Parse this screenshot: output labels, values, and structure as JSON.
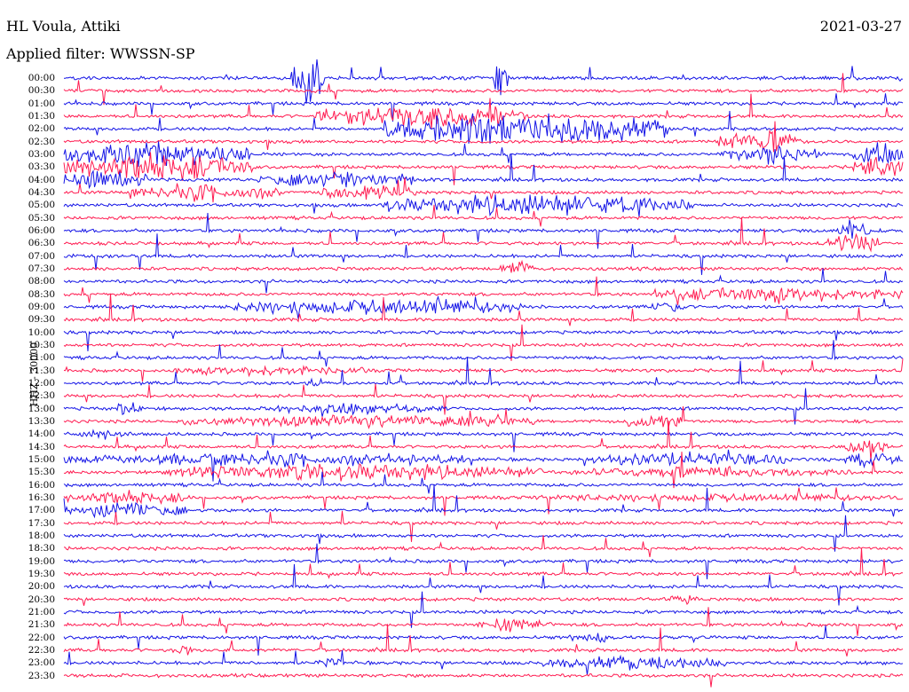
{
  "header": {
    "station": "HL Voula, Attiki",
    "filter": "Applied filter: WWSSN-SP",
    "date": "2021-03-27",
    "channel": "HHZ - 30000"
  },
  "colors": {
    "blue": "#1414e6",
    "red": "#ff1a50"
  },
  "chart_data": {
    "type": "line",
    "title": "HL Voula, Attiki",
    "subtitle": "Applied filter: WWSSN-SP",
    "ylabel": "HHZ - 30000",
    "xlabel": "",
    "grid": false,
    "row_labels": [
      "00:00",
      "00:30",
      "01:00",
      "01:30",
      "02:00",
      "02:30",
      "03:00",
      "03:30",
      "04:00",
      "04:30",
      "05:00",
      "05:30",
      "06:00",
      "06:30",
      "07:00",
      "07:30",
      "08:00",
      "08:30",
      "09:00",
      "09:30",
      "10:00",
      "10:30",
      "11:00",
      "11:30",
      "12:00",
      "12:30",
      "13:00",
      "13:30",
      "14:00",
      "14:30",
      "15:00",
      "15:30",
      "16:00",
      "16:30",
      "17:00",
      "17:30",
      "18:00",
      "18:30",
      "19:00",
      "19:30",
      "20:00",
      "20:30",
      "21:00",
      "21:30",
      "22:00",
      "22:30",
      "23:00",
      "23:30"
    ],
    "series_colors": [
      "blue",
      "red"
    ],
    "trace_minutes": 30,
    "background_amplitude": 0.12,
    "events": [
      {
        "row": 0,
        "start": 0.27,
        "end": 0.31,
        "amplitude": 3.0
      },
      {
        "row": 0,
        "start": 0.51,
        "end": 0.53,
        "amplitude": 2.5
      },
      {
        "row": 3,
        "start": 0.3,
        "end": 0.55,
        "amplitude": 1.4
      },
      {
        "row": 4,
        "start": 0.38,
        "end": 0.72,
        "amplitude": 1.8
      },
      {
        "row": 5,
        "start": 0.78,
        "end": 0.88,
        "amplitude": 1.2
      },
      {
        "row": 6,
        "start": 0.0,
        "end": 0.22,
        "amplitude": 1.6
      },
      {
        "row": 6,
        "start": 0.78,
        "end": 0.9,
        "amplitude": 1.0
      },
      {
        "row": 6,
        "start": 0.94,
        "end": 1.0,
        "amplitude": 1.4
      },
      {
        "row": 7,
        "start": 0.0,
        "end": 0.22,
        "amplitude": 1.6
      },
      {
        "row": 7,
        "start": 0.94,
        "end": 1.0,
        "amplitude": 1.2
      },
      {
        "row": 8,
        "start": 0.0,
        "end": 0.1,
        "amplitude": 1.2
      },
      {
        "row": 8,
        "start": 0.23,
        "end": 0.42,
        "amplitude": 1.0
      },
      {
        "row": 9,
        "start": 0.08,
        "end": 0.26,
        "amplitude": 1.0
      },
      {
        "row": 9,
        "start": 0.3,
        "end": 0.42,
        "amplitude": 0.9
      },
      {
        "row": 10,
        "start": 0.38,
        "end": 0.75,
        "amplitude": 1.2
      },
      {
        "row": 12,
        "start": 0.92,
        "end": 0.96,
        "amplitude": 1.2
      },
      {
        "row": 13,
        "start": 0.91,
        "end": 0.97,
        "amplitude": 1.4
      },
      {
        "row": 15,
        "start": 0.52,
        "end": 0.56,
        "amplitude": 0.8
      },
      {
        "row": 17,
        "start": 0.7,
        "end": 1.0,
        "amplitude": 0.9
      },
      {
        "row": 18,
        "start": 0.2,
        "end": 0.55,
        "amplitude": 1.0
      },
      {
        "row": 18,
        "start": 0.7,
        "end": 0.74,
        "amplitude": 0.8
      },
      {
        "row": 23,
        "start": 0.13,
        "end": 0.36,
        "amplitude": 0.6
      },
      {
        "row": 24,
        "start": 0.29,
        "end": 0.31,
        "amplitude": 0.8
      },
      {
        "row": 26,
        "start": 0.06,
        "end": 0.1,
        "amplitude": 0.8
      },
      {
        "row": 26,
        "start": 0.24,
        "end": 0.46,
        "amplitude": 0.6
      },
      {
        "row": 27,
        "start": 0.14,
        "end": 0.56,
        "amplitude": 0.7
      },
      {
        "row": 27,
        "start": 0.67,
        "end": 0.74,
        "amplitude": 1.0
      },
      {
        "row": 28,
        "start": 0.02,
        "end": 0.08,
        "amplitude": 0.6
      },
      {
        "row": 29,
        "start": 0.93,
        "end": 0.98,
        "amplitude": 1.0
      },
      {
        "row": 30,
        "start": 0.0,
        "end": 0.48,
        "amplitude": 0.8
      },
      {
        "row": 30,
        "start": 0.63,
        "end": 0.86,
        "amplitude": 0.8
      },
      {
        "row": 30,
        "start": 0.93,
        "end": 1.0,
        "amplitude": 0.9
      },
      {
        "row": 31,
        "start": 0.12,
        "end": 0.58,
        "amplitude": 0.9
      },
      {
        "row": 31,
        "start": 0.6,
        "end": 0.94,
        "amplitude": 0.6
      },
      {
        "row": 33,
        "start": 0.0,
        "end": 0.15,
        "amplitude": 0.8
      },
      {
        "row": 33,
        "start": 0.56,
        "end": 1.0,
        "amplitude": 0.5
      },
      {
        "row": 34,
        "start": 0.0,
        "end": 0.15,
        "amplitude": 0.9
      },
      {
        "row": 41,
        "start": 0.72,
        "end": 0.76,
        "amplitude": 0.6
      },
      {
        "row": 43,
        "start": 0.49,
        "end": 0.58,
        "amplitude": 0.8
      },
      {
        "row": 44,
        "start": 0.6,
        "end": 0.66,
        "amplitude": 0.6
      },
      {
        "row": 45,
        "start": 0.13,
        "end": 0.16,
        "amplitude": 0.6
      },
      {
        "row": 46,
        "start": 0.3,
        "end": 0.33,
        "amplitude": 0.6
      },
      {
        "row": 46,
        "start": 0.57,
        "end": 0.79,
        "amplitude": 0.8
      }
    ]
  }
}
